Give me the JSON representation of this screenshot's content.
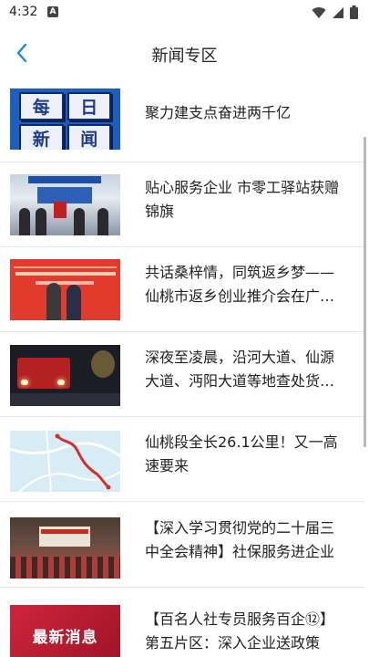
{
  "status_bar": {
    "time": "4:32",
    "notification_icon": "A"
  },
  "header": {
    "title": "新闻专区",
    "back_icon": "chevron-left-icon",
    "accent_color": "#1e88e5"
  },
  "news": [
    {
      "title": "聚力建支点奋进两千亿",
      "thumb_text": [
        "每",
        "日",
        "新",
        "闻"
      ]
    },
    {
      "title": "贴心服务企业 市零工驿站获赠锦旗"
    },
    {
      "title": "共话桑梓情，同筑返乡梦——仙桃市返乡创业推介会在广州举行"
    },
    {
      "title": "深夜至凌晨，沿河大道、仙源大道、沔阳大道等地查处货车违法行为"
    },
    {
      "title": "仙桃段全长26.1公里！又一高速要来"
    },
    {
      "title": "【深入学习贯彻党的二十届三中全会精神】社保服务进企业"
    },
    {
      "title": "【百名人社专员服务百企⑫】第五片区：深入企业送政策",
      "thumb_text": "最新消息"
    }
  ]
}
